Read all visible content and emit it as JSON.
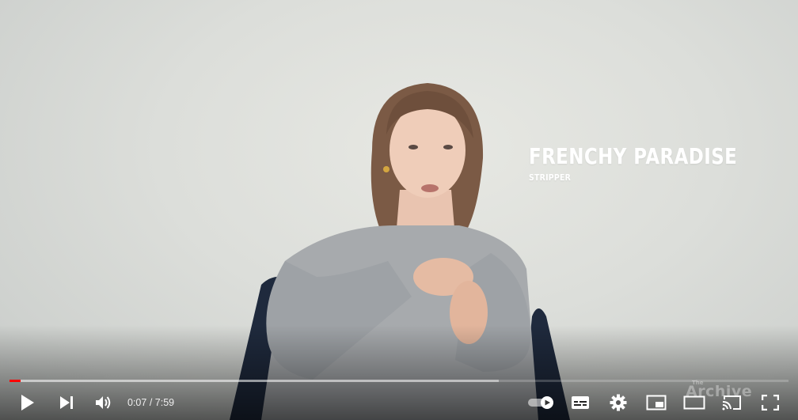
{
  "video": {
    "caption_name": "FRENCHY PARADISE",
    "caption_role": "STRIPPER",
    "watermark_main": "Archive",
    "watermark_small": "The"
  },
  "player": {
    "current_time": "0:07",
    "duration": "7:59",
    "time_display": "0:07 / 7:59",
    "played_fraction": 0.0146,
    "loaded_fraction": 0.628,
    "autoplay_on": true,
    "accent_color": "#ff0000"
  },
  "icons": {
    "play": "play-icon",
    "next": "next-icon",
    "volume": "volume-icon",
    "autoplay": "autoplay-toggle-icon",
    "subtitles": "subtitles-icon",
    "settings": "gear-icon",
    "miniplayer": "miniplayer-icon",
    "theater": "theater-mode-icon",
    "cast": "cast-icon",
    "fullscreen": "fullscreen-icon"
  }
}
